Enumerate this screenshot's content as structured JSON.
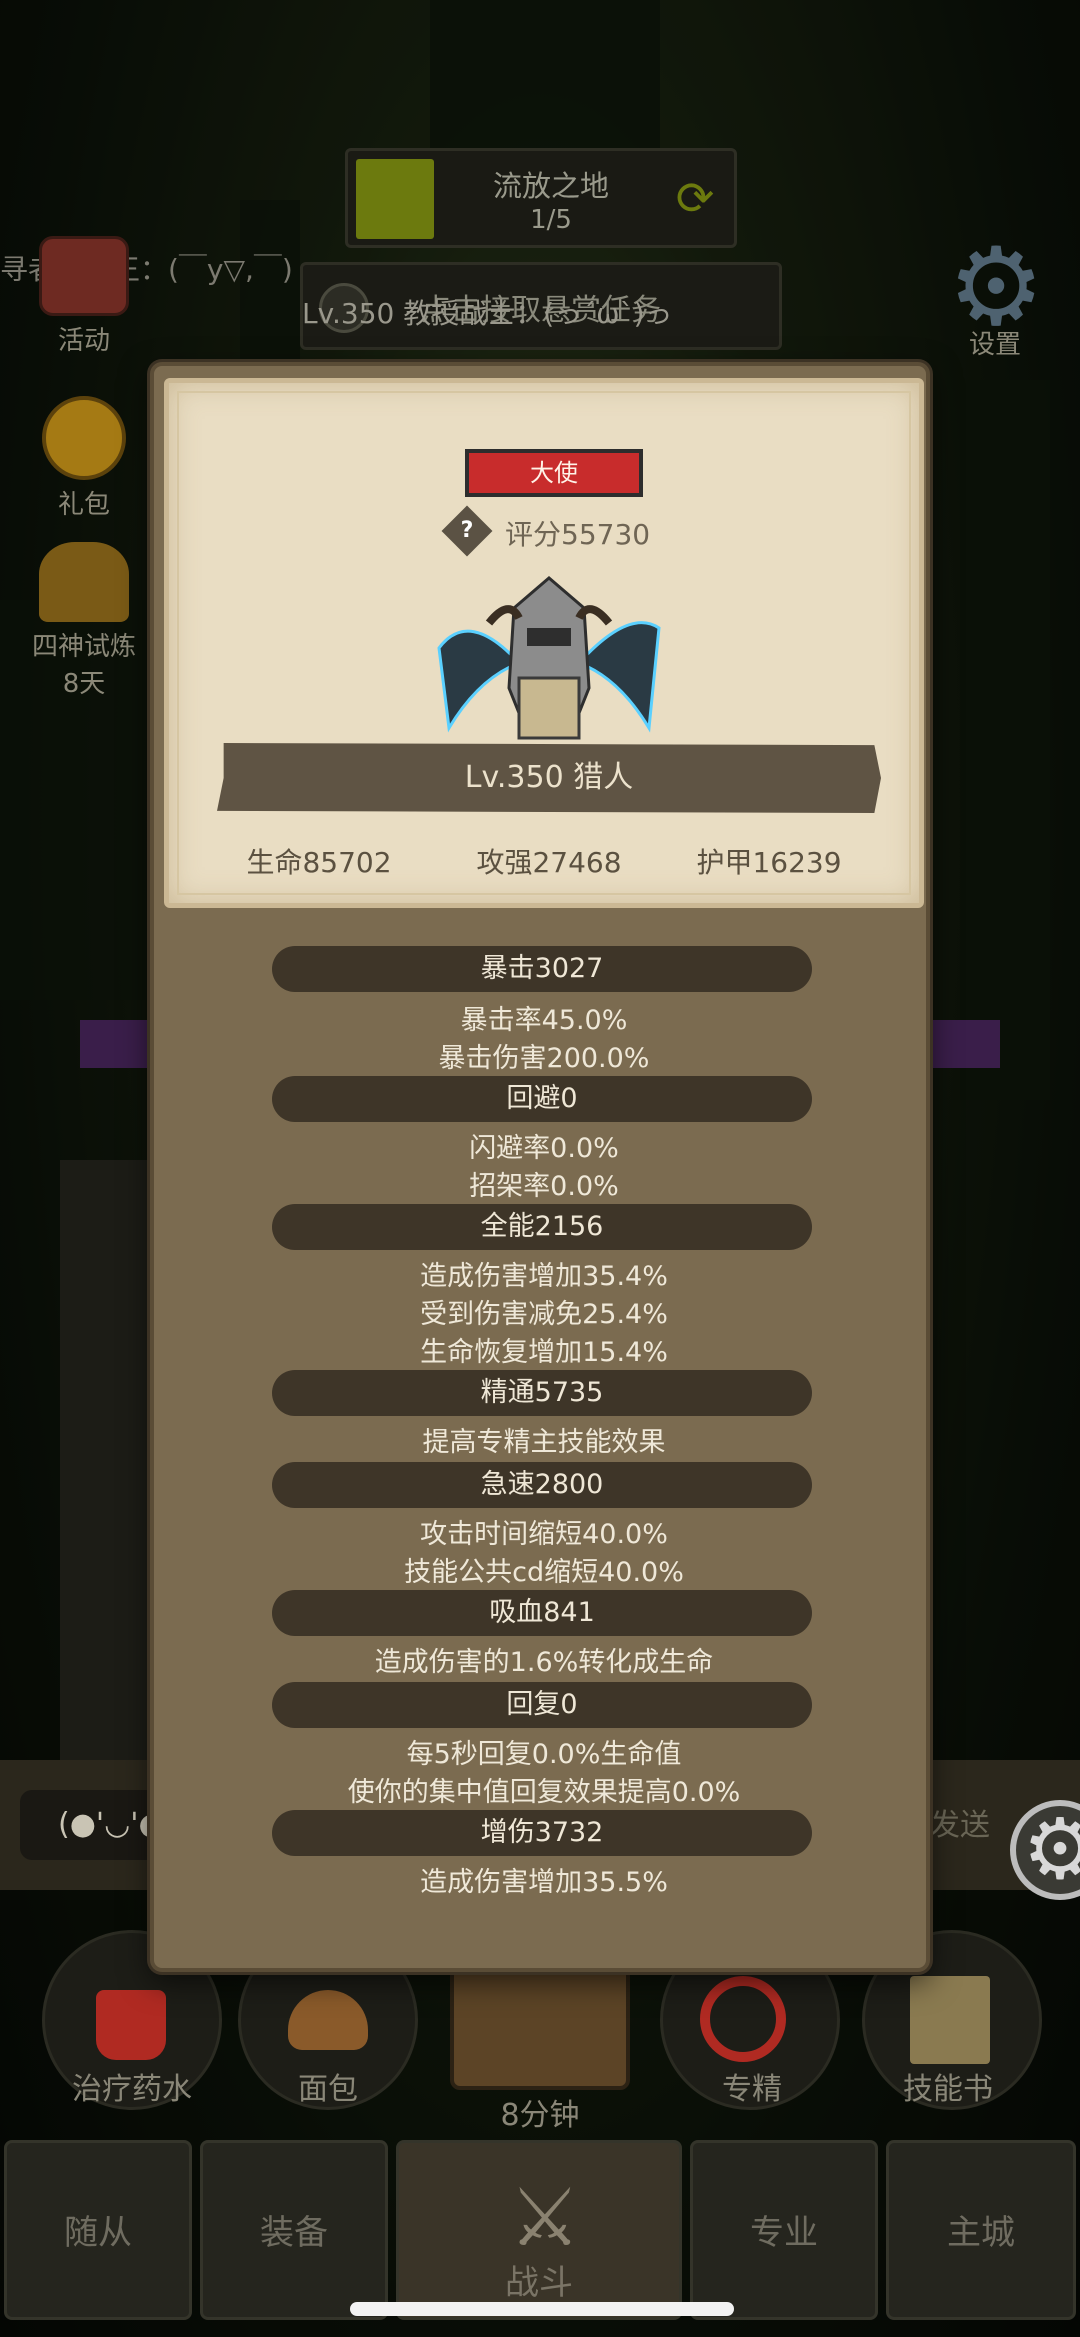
{
  "background": {
    "zone": {
      "title": "流放之地",
      "progress": "1/5",
      "fill_fraction": 0.2
    },
    "bounty": "点击接取悬赏任务",
    "chat_lines": [
      "寻者火车王：(￣y▽,￣)",
      "Lv.350 教授战士：(っ´ω`)っ"
    ],
    "side_buttons": [
      {
        "label": "活动",
        "icon": "event-chest-icon"
      },
      {
        "label": "礼包",
        "icon": "gift-pack-icon"
      },
      {
        "label": "四神试炼",
        "sub": "8天",
        "icon": "four-gods-trial-icon"
      }
    ],
    "settings_label": "设置",
    "chat_input": "(●'◡'●",
    "send_label": "发送",
    "quick_items": [
      {
        "label": "治疗药水",
        "icon": "potion-icon"
      },
      {
        "label": "面包",
        "icon": "bread-icon"
      },
      {
        "label": "8分钟",
        "icon": "treasure-chest-icon"
      },
      {
        "label": "专精",
        "icon": "spec-icon"
      },
      {
        "label": "技能书",
        "icon": "skill-book-icon"
      }
    ],
    "nav_tabs": [
      "随从",
      "装备",
      "战斗",
      "专业",
      "主城"
    ],
    "active_tab": "战斗"
  },
  "modal": {
    "rank": "大使",
    "score": "评分55730",
    "name": "Lv.350 猎人",
    "stats": {
      "hp": "生命85702",
      "atk": "攻强27468",
      "armor": "护甲16239"
    },
    "attributes": [
      {
        "name": "暴击3027",
        "details": [
          "暴击率45.0%",
          "暴击伤害200.0%"
        ]
      },
      {
        "name": "回避0",
        "details": [
          "闪避率0.0%",
          "招架率0.0%"
        ]
      },
      {
        "name": "全能2156",
        "details": [
          "造成伤害增加35.4%",
          "受到伤害减免25.4%",
          "生命恢复增加15.4%"
        ]
      },
      {
        "name": "精通5735",
        "details": [
          "提高专精主技能效果"
        ]
      },
      {
        "name": "急速2800",
        "details": [
          "攻击时间缩短40.0%",
          "技能公共cd缩短40.0%"
        ]
      },
      {
        "name": "吸血841",
        "details": [
          "造成伤害的1.6%转化成生命"
        ]
      },
      {
        "name": "回复0",
        "details": [
          "每5秒回复0.0%生命值",
          "使你的集中值回复效果提高0.0%"
        ]
      },
      {
        "name": "增伤3732",
        "details": [
          "造成伤害增加35.5%"
        ]
      }
    ]
  },
  "colors": {
    "rank_badge": "#c82c2c",
    "modal_bg": "#7b6b50",
    "card_bg": "#e9ddc3",
    "zone_fill": "#6c7a0e"
  }
}
